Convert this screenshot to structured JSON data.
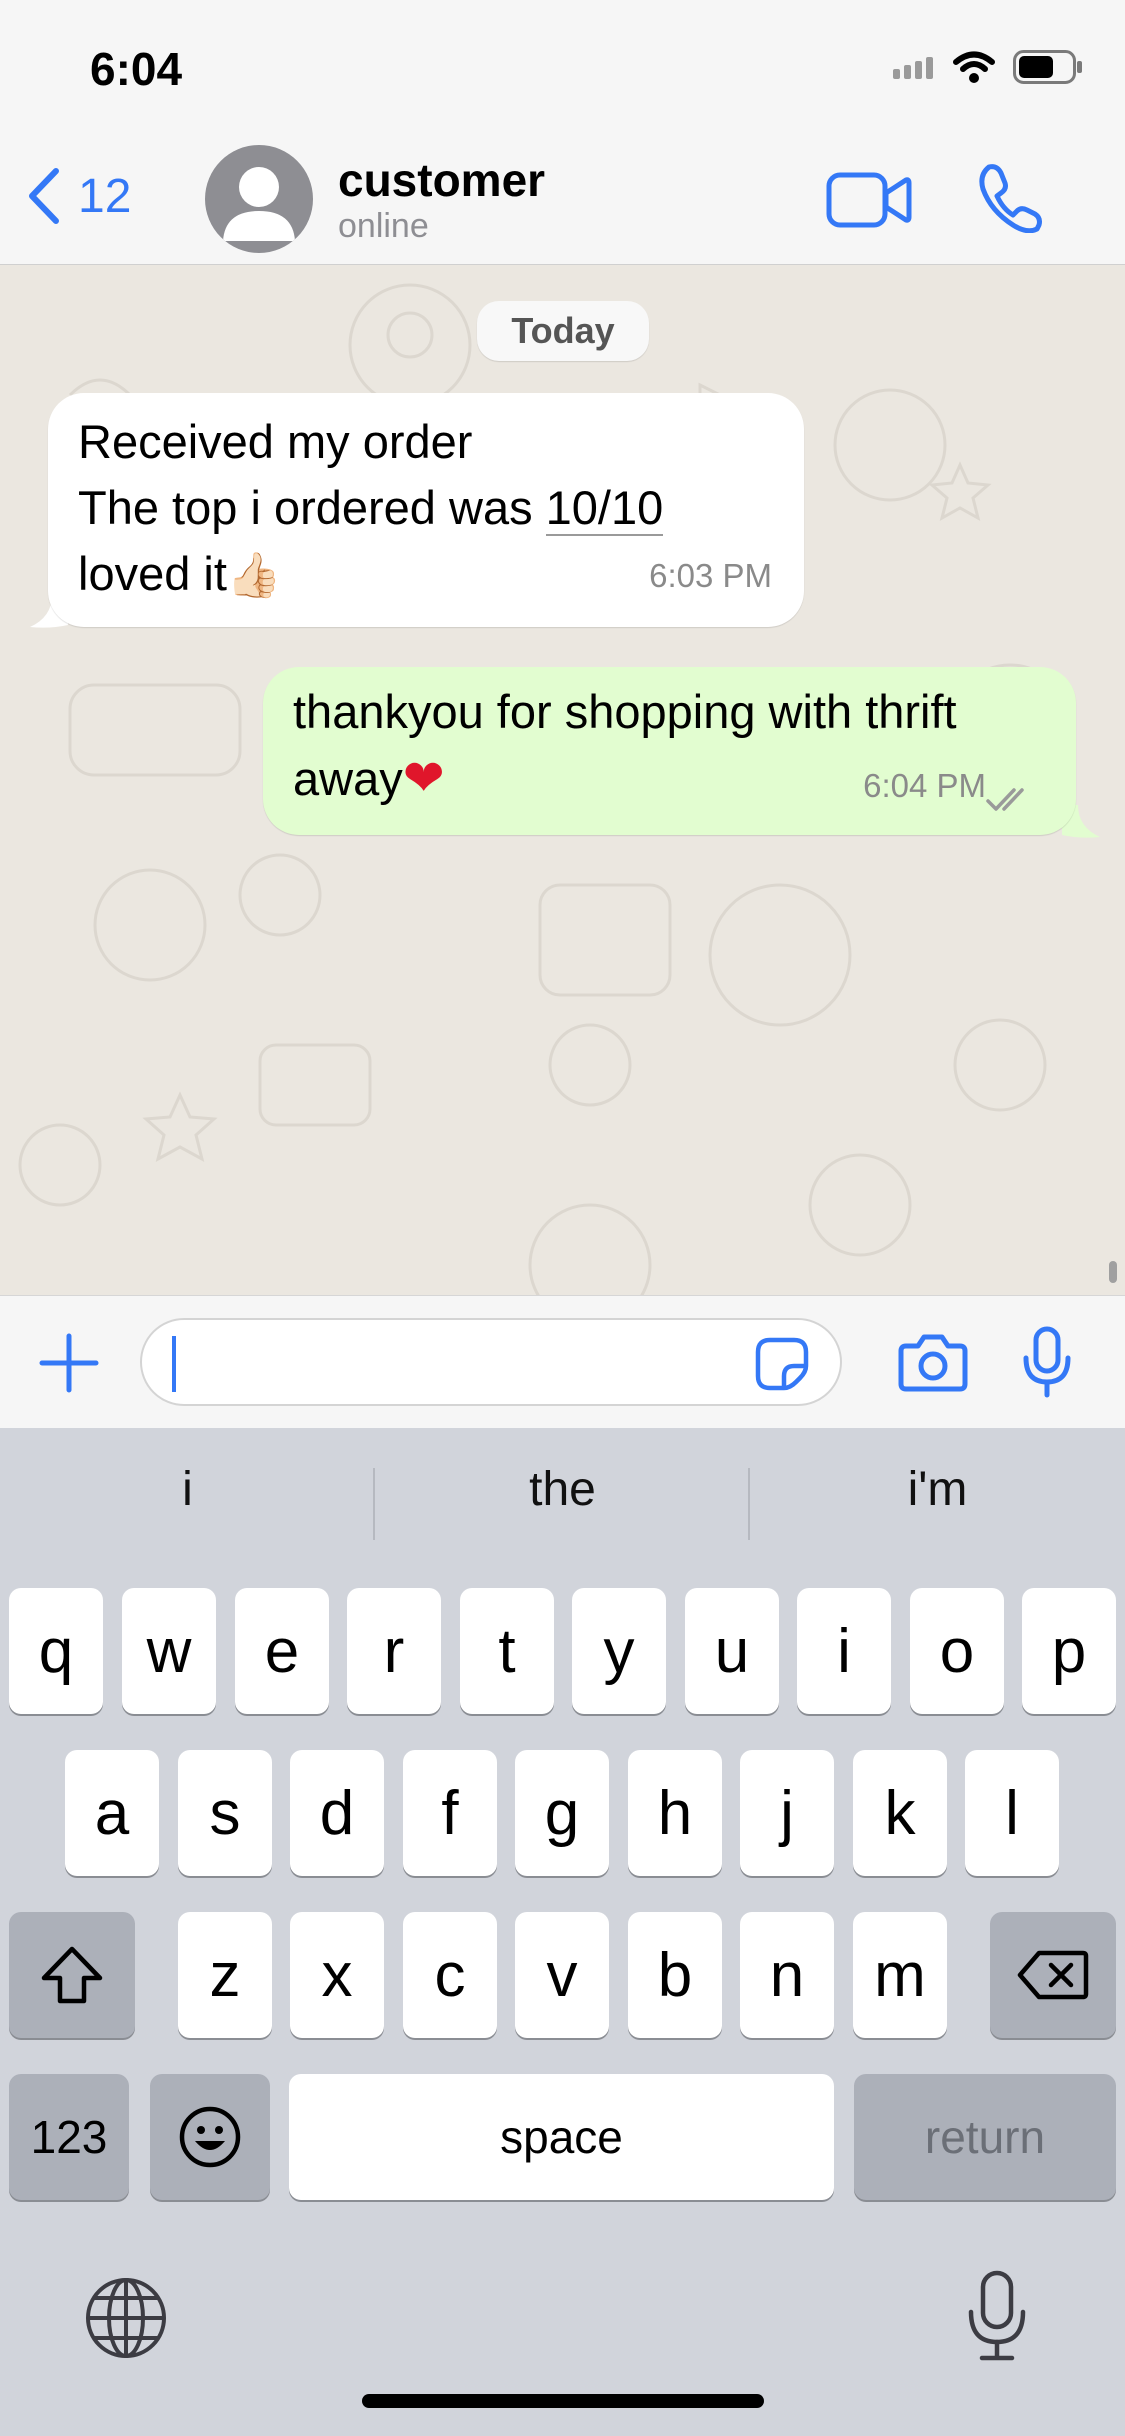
{
  "status_bar": {
    "time": "6:04"
  },
  "header": {
    "back_count": "12",
    "contact_name": "customer",
    "contact_status": "online"
  },
  "chat": {
    "date_label": "Today",
    "messages": [
      {
        "direction": "incoming",
        "line1": "Received my order",
        "line2_prefix": "The top i ordered was ",
        "line2_underlined": "10/10",
        "line3": "loved it",
        "emoji": "👍🏻",
        "time": "6:03 PM"
      },
      {
        "direction": "outgoing",
        "line1": "thankyou for shopping with thrift",
        "line2": "away",
        "emoji": "❤",
        "time": "6:04 PM",
        "status": "read"
      }
    ]
  },
  "input": {
    "placeholder": ""
  },
  "keyboard": {
    "suggestions": [
      "i",
      "the",
      "i'm"
    ],
    "row1": [
      "q",
      "w",
      "e",
      "r",
      "t",
      "y",
      "u",
      "i",
      "o",
      "p"
    ],
    "row2": [
      "a",
      "s",
      "d",
      "f",
      "g",
      "h",
      "j",
      "k",
      "l"
    ],
    "row3": [
      "z",
      "x",
      "c",
      "v",
      "b",
      "n",
      "m"
    ],
    "numbers_label": "123",
    "space_label": "space",
    "return_label": "return"
  },
  "colors": {
    "accent": "#3478f6",
    "outgoing_bubble": "#e2fdd0",
    "chat_background": "#ebe7e0",
    "keyboard_background": "#d1d4db"
  },
  "icons": [
    "signal-icon",
    "wifi-icon",
    "battery-icon",
    "back-chevron-icon",
    "avatar-icon",
    "video-call-icon",
    "phone-icon",
    "plus-icon",
    "sticker-icon",
    "camera-icon",
    "microphone-icon",
    "shift-icon",
    "backspace-icon",
    "emoji-icon",
    "globe-icon",
    "dictation-icon",
    "double-check-icon"
  ]
}
